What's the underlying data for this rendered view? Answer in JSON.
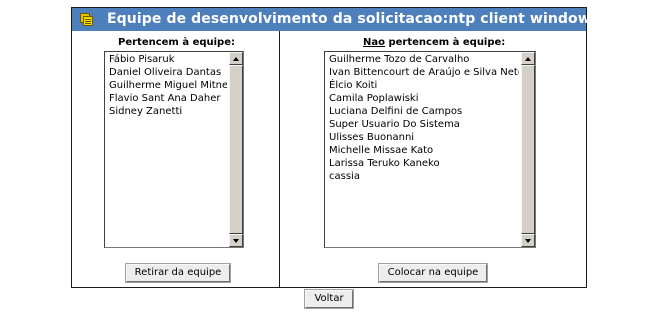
{
  "header": {
    "title": "Equipe de desenvolvimento da solicitacao:ntp client windows",
    "icon": "folder-stack-icon"
  },
  "left": {
    "heading": "Pertencem à equipe:",
    "members": [
      "Fábio Pisaruk",
      "Daniel Oliveira Dantas",
      "Guilherme Miguel Mitne",
      "Flavio Sant Ana Daher",
      "Sidney Zanetti"
    ],
    "button_label": "Retirar da equipe"
  },
  "right": {
    "heading_underlined": "Nao",
    "heading_rest": " pertencem à equipe:",
    "non_members": [
      "Guilherme Tozo de Carvalho",
      "Ivan Bittencourt de Araújo e Silva Neto",
      "Élcio Koiti",
      "Camila Poplawiski",
      "Luciana Delfini de Campos",
      "Super Usuario Do Sistema",
      "Ulisses Buonanni",
      "Michelle Missae Kato",
      "Larissa Teruko Kaneko",
      "cassia"
    ],
    "button_label": "Colocar na equipe"
  },
  "footer": {
    "back_label": "Voltar"
  },
  "colors": {
    "title_bar": "#4d7fbd",
    "title_text": "#ffffff",
    "border": "#1b1b1b"
  }
}
